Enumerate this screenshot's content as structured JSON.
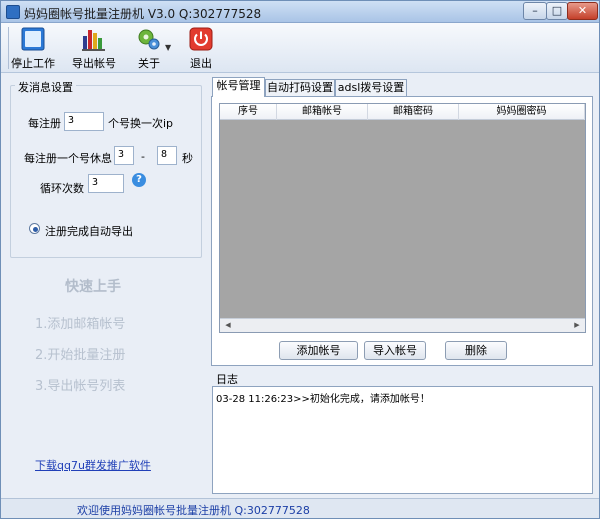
{
  "window": {
    "title": "妈妈圈帐号批量注册机 V3.0  Q:302777528",
    "controls": {
      "minimize": "–",
      "maximize": "□",
      "close": "✕"
    }
  },
  "toolbar": {
    "stop_label": "停止工作",
    "export_label": "导出帐号",
    "about_label": "关于",
    "exit_label": "退出"
  },
  "settings": {
    "group_title": "发消息设置",
    "per_reg_label": "每注册",
    "per_reg_value": "3",
    "per_reg_suffix": "个号换一次ip",
    "rest_label": "每注册一个号休息",
    "rest_min": "3",
    "rest_dash": "-",
    "rest_max": "8",
    "rest_unit": "秒",
    "loop_label": "循环次数",
    "loop_value": "3",
    "help_glyph": "?",
    "auto_export_label": "注册完成自动导出"
  },
  "quick_start": {
    "title": "快速上手",
    "steps": [
      "1.添加邮箱帐号",
      "2.开始批量注册",
      "3.导出帐号列表"
    ]
  },
  "download_link": "下载qq7u群发推广软件",
  "tabs": [
    {
      "label": "帐号管理",
      "active": true
    },
    {
      "label": "自动打码设置",
      "active": false
    },
    {
      "label": "adsl拨号设置",
      "active": false
    }
  ],
  "table": {
    "columns": [
      "序号",
      "邮箱帐号",
      "邮箱密码",
      "妈妈圈密码"
    ],
    "rows": []
  },
  "buttons": {
    "add": "添加帐号",
    "import": "导入帐号",
    "delete": "删除"
  },
  "log": {
    "title": "日志",
    "lines": [
      "03-28 11:26:23>>初始化完成，请添加帐号！"
    ]
  },
  "status_bar": "欢迎使用妈妈圈帐号批量注册机 Q:302777528"
}
